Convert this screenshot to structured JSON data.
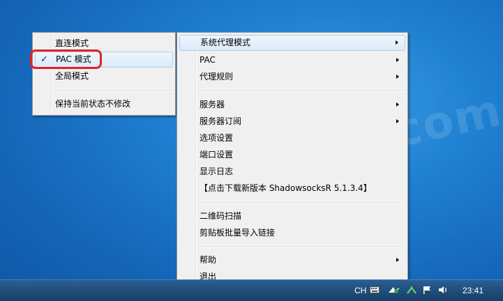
{
  "watermark": "worldss.com",
  "left_menu": {
    "items": [
      {
        "label": "直连模式"
      },
      {
        "label": "PAC 模式",
        "checked": true
      },
      {
        "label": "全局模式"
      },
      {
        "label": "保持当前状态不修改"
      }
    ],
    "check_mark": "✓"
  },
  "right_menu": {
    "items": [
      {
        "label": "系统代理模式",
        "submenu": true
      },
      {
        "label": "PAC",
        "submenu": true
      },
      {
        "label": "代理规则",
        "submenu": true
      },
      {
        "label": "服务器",
        "submenu": true
      },
      {
        "label": "服务器订阅",
        "submenu": true
      },
      {
        "label": "选项设置"
      },
      {
        "label": "端口设置"
      },
      {
        "label": "显示日志"
      },
      {
        "label": "【点击下载新版本 ShadowsocksR 5.1.3.4】"
      },
      {
        "label": "二维码扫描"
      },
      {
        "label": "剪贴板批量导入链接"
      },
      {
        "label": "帮助",
        "submenu": true
      },
      {
        "label": "退出"
      }
    ]
  },
  "taskbar": {
    "lang": "CH",
    "clock": "23:41"
  },
  "colors": {
    "highlight_box": "#e32222",
    "menu_bg": "#f0f0f0",
    "hover_bg": "#dcebfa"
  },
  "icons": [
    "keyboard-icon",
    "shadowsocks-icon",
    "network-icon",
    "flag-icon",
    "volume-icon"
  ]
}
